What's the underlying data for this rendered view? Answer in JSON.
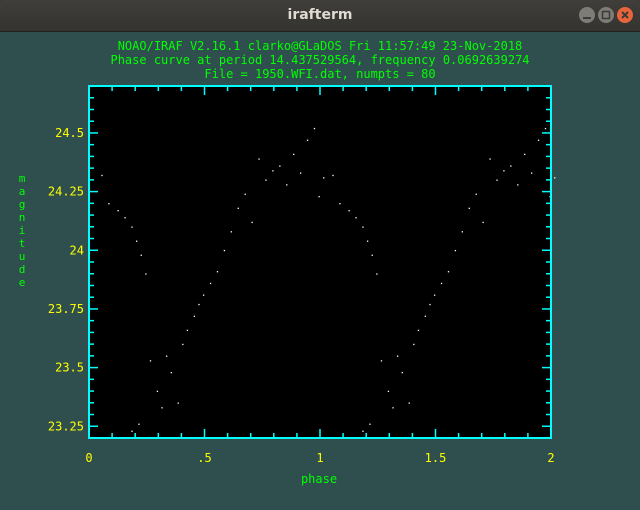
{
  "window": {
    "title": "irafterm",
    "buttons": [
      "minimize",
      "maximize",
      "close"
    ]
  },
  "header": {
    "line1": "NOAO/IRAF V2.16.1 clarko@GLaDOS Fri 11:57:49 23-Nov-2018",
    "line2": "Phase curve at period 14.437529564, frequency 0.0692639274",
    "line3": "File = 1950.WFI.dat, numpts = 80"
  },
  "colors": {
    "background": "#2f4f4f",
    "text": "#00ff00",
    "axes": "#00ffff",
    "tick_labels": "#ffff00",
    "plot_bg": "#000000",
    "points": "#ffffff"
  },
  "chart_data": {
    "type": "scatter",
    "title": "",
    "xlabel": "phase",
    "ylabel": "magnitude",
    "xlim": [
      0,
      2
    ],
    "ylim": [
      23.2,
      24.7
    ],
    "x_ticks": [
      "0",
      ".5",
      "1",
      "1.5",
      "2"
    ],
    "y_ticks": [
      "23.25",
      "23.5",
      "23.75",
      "24",
      "24.25",
      "24.5"
    ],
    "y_tick_values": [
      23.25,
      23.5,
      23.75,
      24,
      24.25,
      24.5
    ],
    "x_tick_values": [
      0,
      0.5,
      1,
      1.5,
      2
    ],
    "points": [
      [
        0.03,
        24.37
      ],
      [
        0.06,
        24.25
      ],
      [
        0.1,
        24.22
      ],
      [
        0.13,
        24.19
      ],
      [
        0.16,
        24.15
      ],
      [
        0.18,
        24.09
      ],
      [
        0.2,
        24.03
      ],
      [
        0.22,
        23.95
      ],
      [
        0.24,
        23.58
      ],
      [
        0.27,
        23.45
      ],
      [
        0.29,
        23.38
      ],
      [
        0.31,
        23.6
      ],
      [
        0.33,
        23.53
      ],
      [
        0.36,
        23.4
      ],
      [
        0.38,
        23.65
      ],
      [
        0.4,
        23.71
      ],
      [
        0.43,
        23.77
      ],
      [
        0.45,
        23.82
      ],
      [
        0.47,
        23.86
      ],
      [
        0.5,
        23.91
      ],
      [
        0.53,
        23.96
      ],
      [
        0.56,
        24.05
      ],
      [
        0.59,
        24.13
      ],
      [
        0.62,
        24.23
      ],
      [
        0.65,
        24.29
      ],
      [
        0.68,
        24.17
      ],
      [
        0.71,
        24.44
      ],
      [
        0.74,
        24.35
      ],
      [
        0.77,
        24.39
      ],
      [
        0.8,
        24.41
      ],
      [
        0.83,
        24.33
      ],
      [
        0.86,
        24.46
      ],
      [
        0.89,
        24.38
      ],
      [
        0.92,
        24.52
      ],
      [
        0.95,
        24.57
      ],
      [
        0.97,
        24.28
      ],
      [
        0.99,
        24.36
      ],
      [
        0.16,
        23.28
      ],
      [
        0.19,
        23.31
      ],
      [
        0.14,
        23.25
      ],
      [
        1.03,
        24.37
      ],
      [
        1.06,
        24.25
      ],
      [
        1.1,
        24.22
      ],
      [
        1.13,
        24.19
      ],
      [
        1.16,
        24.15
      ],
      [
        1.18,
        24.09
      ],
      [
        1.2,
        24.03
      ],
      [
        1.22,
        23.95
      ],
      [
        1.24,
        23.58
      ],
      [
        1.27,
        23.45
      ],
      [
        1.29,
        23.38
      ],
      [
        1.31,
        23.6
      ],
      [
        1.33,
        23.53
      ],
      [
        1.36,
        23.4
      ],
      [
        1.38,
        23.65
      ],
      [
        1.4,
        23.71
      ],
      [
        1.43,
        23.77
      ],
      [
        1.45,
        23.82
      ],
      [
        1.47,
        23.86
      ],
      [
        1.5,
        23.91
      ],
      [
        1.53,
        23.96
      ],
      [
        1.56,
        24.05
      ],
      [
        1.59,
        24.13
      ],
      [
        1.62,
        24.23
      ],
      [
        1.65,
        24.29
      ],
      [
        1.68,
        24.17
      ],
      [
        1.71,
        24.44
      ],
      [
        1.74,
        24.35
      ],
      [
        1.77,
        24.39
      ],
      [
        1.8,
        24.41
      ],
      [
        1.83,
        24.33
      ],
      [
        1.86,
        24.46
      ],
      [
        1.89,
        24.38
      ],
      [
        1.92,
        24.52
      ],
      [
        1.95,
        24.57
      ],
      [
        1.97,
        24.28
      ],
      [
        1.99,
        24.36
      ],
      [
        1.16,
        23.28
      ],
      [
        1.19,
        23.31
      ],
      [
        1.14,
        23.25
      ]
    ]
  }
}
